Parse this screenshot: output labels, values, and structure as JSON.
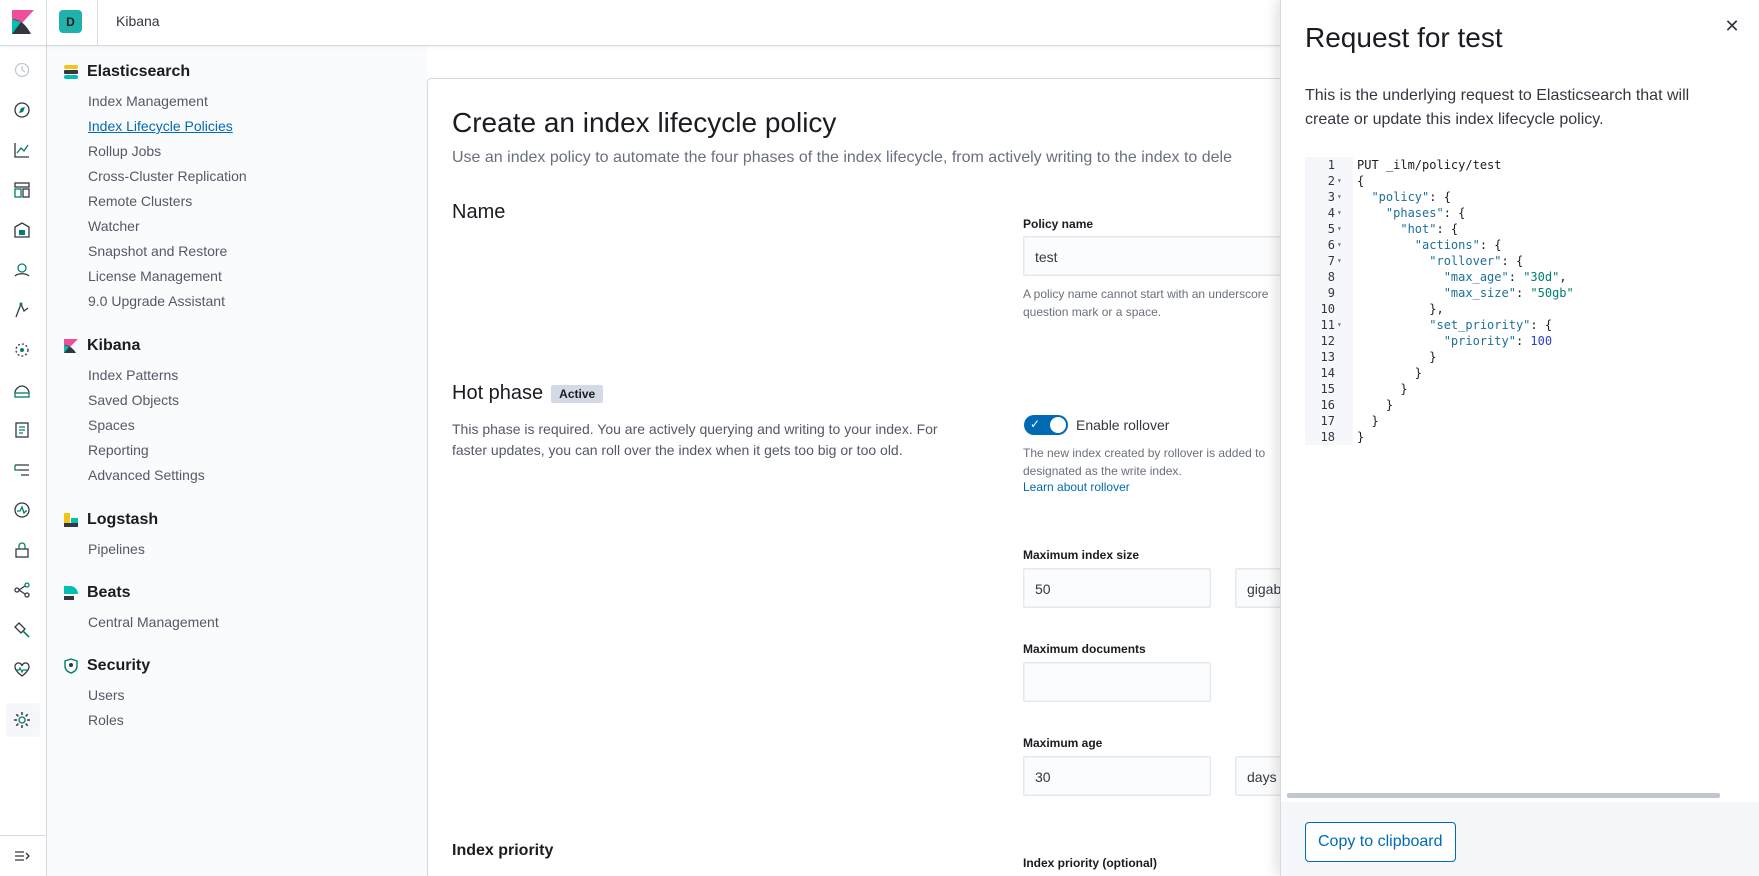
{
  "header": {
    "space_initial": "D",
    "app_title": "Kibana"
  },
  "icon_nav": {
    "icons": [
      "recently-viewed-icon",
      "discover-icon",
      "visualize-icon",
      "dashboard-icon",
      "canvas-icon",
      "maps-icon",
      "ml-icon",
      "graph-icon",
      "infrastructure-icon",
      "logs-icon",
      "apm-icon",
      "uptime-icon",
      "siem-icon",
      "dev-tools-icon",
      "stack-monitoring-icon",
      "heartbeat-icon",
      "management-icon"
    ],
    "collapse_icon": "menu-collapse-icon"
  },
  "management": {
    "elasticsearch": {
      "title": "Elasticsearch",
      "items": [
        "Index Management",
        "Index Lifecycle Policies",
        "Rollup Jobs",
        "Cross-Cluster Replication",
        "Remote Clusters",
        "Watcher",
        "Snapshot and Restore",
        "License Management",
        "9.0 Upgrade Assistant"
      ]
    },
    "kibana": {
      "title": "Kibana",
      "items": [
        "Index Patterns",
        "Saved Objects",
        "Spaces",
        "Reporting",
        "Advanced Settings"
      ]
    },
    "logstash": {
      "title": "Logstash",
      "items": [
        "Pipelines"
      ]
    },
    "beats": {
      "title": "Beats",
      "items": [
        "Central Management"
      ]
    },
    "security": {
      "title": "Security",
      "items": [
        "Users",
        "Roles"
      ]
    }
  },
  "main": {
    "title": "Create an index lifecycle policy",
    "description": "Use an index policy to automate the four phases of the index lifecycle, from actively writing to the index to dele",
    "name_section": "Name",
    "policy_name_label": "Policy name",
    "policy_name_value": "test",
    "policy_name_help_1": "A policy name cannot start with an underscore",
    "policy_name_help_2": "question mark or a space.",
    "hot_phase": {
      "title": "Hot phase",
      "badge": "Active",
      "description": "This phase is required. You are actively querying and writing to your index. For faster updates, you can roll over the index when it gets too big or too old.",
      "rollover_label": "Enable rollover",
      "rollover_help_1": "The new index created by rollover is added to",
      "rollover_help_2": "designated as the write index.",
      "rollover_link": "Learn about rollover",
      "max_size_label": "Maximum index size",
      "max_size_value": "50",
      "max_size_unit": "gigab",
      "max_docs_label": "Maximum documents",
      "max_docs_value": "",
      "max_age_label": "Maximum age",
      "max_age_value": "30",
      "max_age_unit": "days"
    },
    "index_priority_title": "Index priority",
    "index_priority_label": "Index priority (optional)"
  },
  "flyout": {
    "title": "Request for test",
    "description": "This is the underlying request to Elasticsearch that will create or update this index lifecycle policy.",
    "copy_button": "Copy to clipboard",
    "code_lines": [
      {
        "n": "1",
        "fold": false,
        "indent": 0,
        "parts": [
          [
            "t",
            "PUT _ilm/policy/test"
          ]
        ]
      },
      {
        "n": "2",
        "fold": true,
        "indent": 0,
        "parts": [
          [
            "t",
            "{"
          ]
        ]
      },
      {
        "n": "3",
        "fold": true,
        "indent": 1,
        "parts": [
          [
            "k",
            "\"policy\""
          ],
          [
            "t",
            ": {"
          ]
        ]
      },
      {
        "n": "4",
        "fold": true,
        "indent": 2,
        "parts": [
          [
            "k",
            "\"phases\""
          ],
          [
            "t",
            ": {"
          ]
        ]
      },
      {
        "n": "5",
        "fold": true,
        "indent": 3,
        "parts": [
          [
            "k",
            "\"hot\""
          ],
          [
            "t",
            ": {"
          ]
        ]
      },
      {
        "n": "6",
        "fold": true,
        "indent": 4,
        "parts": [
          [
            "k",
            "\"actions\""
          ],
          [
            "t",
            ": {"
          ]
        ]
      },
      {
        "n": "7",
        "fold": true,
        "indent": 5,
        "parts": [
          [
            "k",
            "\"rollover\""
          ],
          [
            "t",
            ": {"
          ]
        ]
      },
      {
        "n": "8",
        "fold": false,
        "indent": 6,
        "parts": [
          [
            "k",
            "\"max_age\""
          ],
          [
            "t",
            ": "
          ],
          [
            "s",
            "\"30d\""
          ],
          [
            "t",
            ","
          ]
        ]
      },
      {
        "n": "9",
        "fold": false,
        "indent": 6,
        "parts": [
          [
            "k",
            "\"max_size\""
          ],
          [
            "t",
            ": "
          ],
          [
            "s",
            "\"50gb\""
          ]
        ]
      },
      {
        "n": "10",
        "fold": false,
        "indent": 5,
        "parts": [
          [
            "t",
            "},"
          ]
        ]
      },
      {
        "n": "11",
        "fold": true,
        "indent": 5,
        "parts": [
          [
            "k",
            "\"set_priority\""
          ],
          [
            "t",
            ": {"
          ]
        ]
      },
      {
        "n": "12",
        "fold": false,
        "indent": 6,
        "parts": [
          [
            "k",
            "\"priority\""
          ],
          [
            "t",
            ": "
          ],
          [
            "n",
            "100"
          ]
        ]
      },
      {
        "n": "13",
        "fold": false,
        "indent": 5,
        "parts": [
          [
            "t",
            "}"
          ]
        ]
      },
      {
        "n": "14",
        "fold": false,
        "indent": 4,
        "parts": [
          [
            "t",
            "}"
          ]
        ]
      },
      {
        "n": "15",
        "fold": false,
        "indent": 3,
        "parts": [
          [
            "t",
            "}"
          ]
        ]
      },
      {
        "n": "16",
        "fold": false,
        "indent": 2,
        "parts": [
          [
            "t",
            "}"
          ]
        ]
      },
      {
        "n": "17",
        "fold": false,
        "indent": 1,
        "parts": [
          [
            "t",
            "}"
          ]
        ]
      },
      {
        "n": "18",
        "fold": false,
        "indent": 0,
        "parts": [
          [
            "t",
            "}"
          ]
        ]
      }
    ]
  },
  "colors": {
    "accent": "#006bb4",
    "space_avatar": "#20b2aa"
  }
}
